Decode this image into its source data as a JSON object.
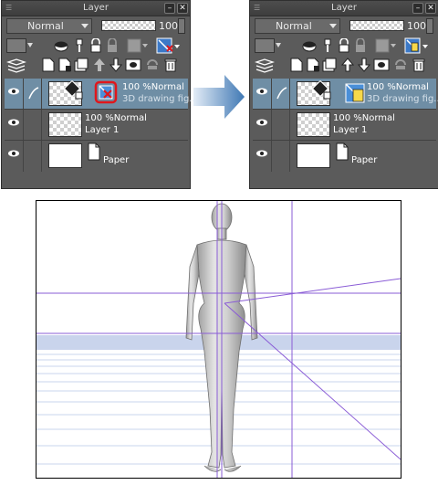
{
  "panels": [
    {
      "title": "Layer",
      "blend_mode": "Normal",
      "opacity": "100",
      "layers": [
        {
          "label1": "100 %Normal",
          "label2": "3D drawing fig..."
        },
        {
          "label1": "100 %Normal",
          "label2": "Layer 1"
        },
        {
          "label1": "",
          "label2": "Paper"
        }
      ]
    },
    {
      "title": "Layer",
      "blend_mode": "Normal",
      "opacity": "100",
      "layers": [
        {
          "label1": "100 %Normal",
          "label2": "3D drawing fig..."
        },
        {
          "label1": "100 %Normal",
          "label2": "Layer 1"
        },
        {
          "label1": "",
          "label2": "Paper"
        }
      ]
    }
  ],
  "colors": {
    "panel_bg": "#5b5b5b",
    "selected_row": "#6f8ea5",
    "highlight_ring": "#e0171c",
    "arrow_blue": "#4a7fb5",
    "guide_purple": "#8a5cd6",
    "ground_blue": "#c9d4ec"
  },
  "icons": [
    "menu-grip-icon",
    "minimize-icon",
    "close-icon",
    "layer-color-icon",
    "mask-icon",
    "pin-icon",
    "lock-icon",
    "lock-alpha-icon",
    "reference-icon",
    "ruler-3d-icon",
    "new-raster-layer-icon",
    "new-vector-layer-icon",
    "new-folder-icon",
    "transfer-down-icon",
    "merge-down-icon",
    "layer-mask-icon",
    "ruler-icon",
    "delete-icon",
    "eye-icon",
    "pen-icon"
  ]
}
